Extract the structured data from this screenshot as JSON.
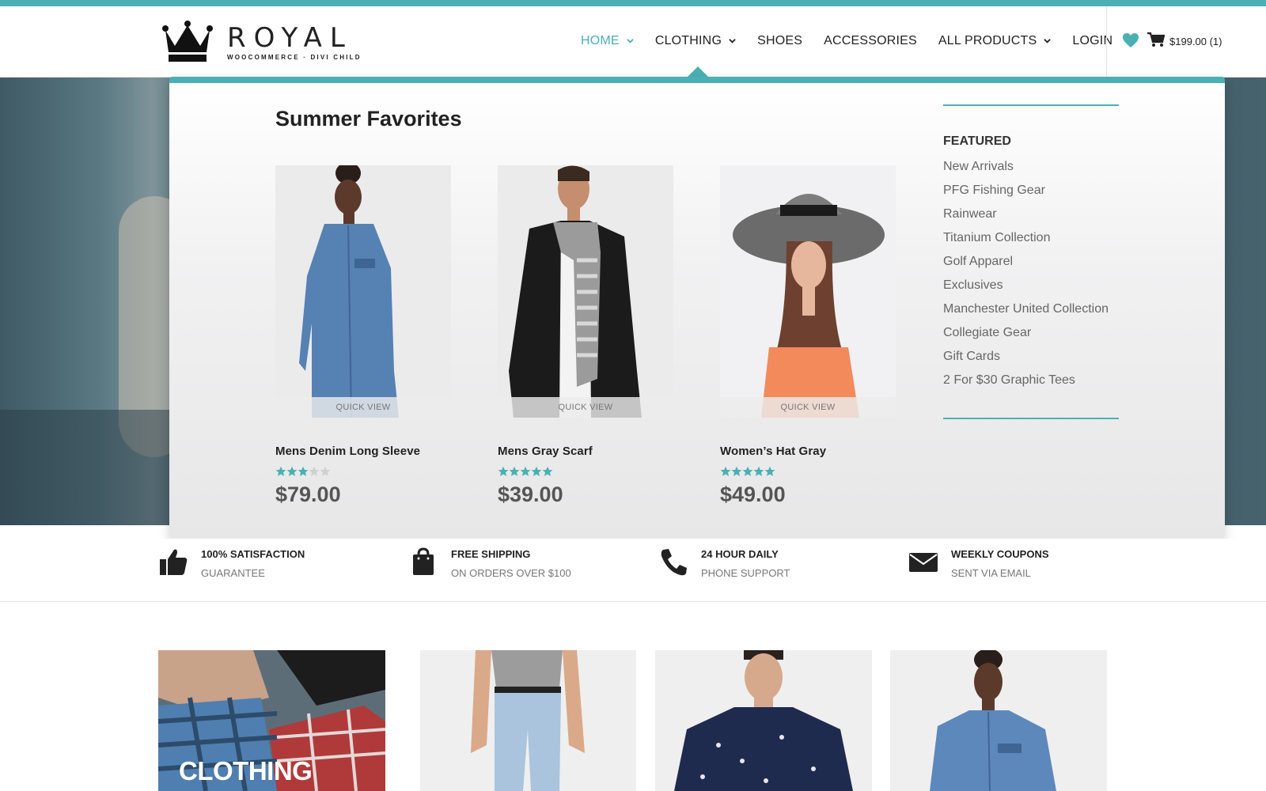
{
  "brand": {
    "title": "ROYAL",
    "subtitle": "WOOCOMMERCE · DIVI CHILD"
  },
  "nav": {
    "items": [
      {
        "label": "HOME",
        "dropdown": true,
        "active": true
      },
      {
        "label": "CLOTHING",
        "dropdown": true,
        "active": false
      },
      {
        "label": "SHOES",
        "dropdown": false,
        "active": false
      },
      {
        "label": "ACCESSORIES",
        "dropdown": false,
        "active": false
      },
      {
        "label": "ALL PRODUCTS",
        "dropdown": true,
        "active": false
      },
      {
        "label": "LOGIN",
        "dropdown": false,
        "active": false
      }
    ],
    "cart_label": "$199.00 (1)"
  },
  "mega_menu": {
    "title": "Summer Favorites",
    "products": [
      {
        "name": "Mens Denim Long Sleeve",
        "price": "$79.00",
        "rating": 3,
        "quick_view": "QUICK VIEW"
      },
      {
        "name": "Mens Gray Scarf",
        "price": "$39.00",
        "rating": 5,
        "quick_view": "QUICK VIEW"
      },
      {
        "name": "Women’s Hat Gray",
        "price": "$49.00",
        "rating": 5,
        "quick_view": "QUICK VIEW"
      }
    ],
    "featured": {
      "title": "FEATURED",
      "links": [
        "New Arrivals",
        "PFG Fishing Gear",
        "Rainwear",
        "Titanium Collection",
        "Golf Apparel",
        "Exclusives",
        "Manchester United Collection",
        "Collegiate Gear",
        "Gift Cards",
        "2 For $30 Graphic Tees"
      ]
    }
  },
  "features": [
    {
      "icon": "thumbs-up-icon",
      "title": "100% SATISFACTION",
      "subtitle": "GUARANTEE"
    },
    {
      "icon": "shopping-bag-icon",
      "title": "FREE SHIPPING",
      "subtitle": "ON ORDERS OVER $100"
    },
    {
      "icon": "phone-icon",
      "title": "24 HOUR DAILY",
      "subtitle": "PHONE SUPPORT"
    },
    {
      "icon": "envelope-icon",
      "title": "WEEKLY COUPONS",
      "subtitle": "SENT VIA EMAIL"
    }
  ],
  "categories": {
    "tile1_label": "CLOTHING"
  },
  "colors": {
    "accent": "#4bb0b3",
    "text": "#222222",
    "muted": "#777777"
  }
}
